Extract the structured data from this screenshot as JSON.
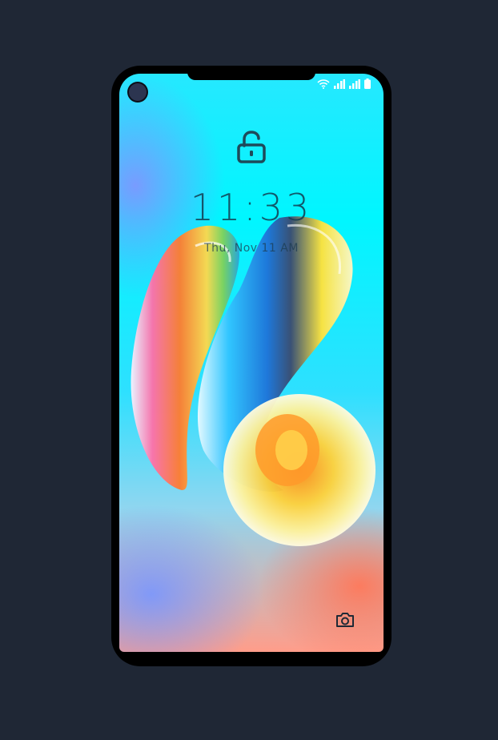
{
  "lockscreen": {
    "time": "11:33",
    "date": "Thu, Nov 11 AM"
  },
  "status_bar": {
    "icons": [
      "wifi-icon",
      "signal-icon",
      "signal-icon",
      "battery-icon"
    ]
  },
  "icons": {
    "lock": "unlocked-padlock-icon",
    "camera": "camera-icon"
  },
  "colors": {
    "background": "#1f2735",
    "phone_frame": "#000000",
    "text": "#143c50",
    "icon": "#1e3a4a"
  }
}
